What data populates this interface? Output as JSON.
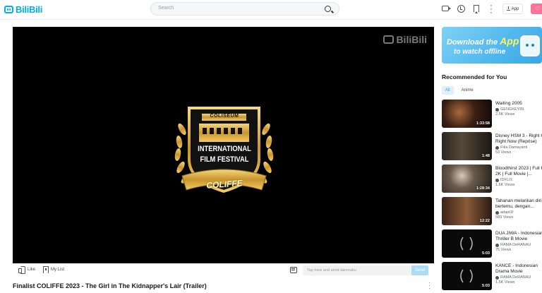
{
  "header": {
    "logo_text": "BiliBili",
    "search_placeholder": "Search",
    "app_label": "App",
    "pink_label": "♡"
  },
  "player": {
    "watermark": "BiliBili",
    "festival": {
      "top": "COLISEUM",
      "line1": "INTERNATIONAL",
      "line2": "FILM FESTIVAL",
      "ribbon": "COLIFFE"
    }
  },
  "toolbar": {
    "like_label": "Like",
    "mylist_label": "My List",
    "danmaku_placeholder": "Tap here and send danmaku",
    "send_label": "Send"
  },
  "video": {
    "title": "Finalist COLIFFE 2023 - The Girl in The Kidnapper's Lair (Trailer)"
  },
  "sidebar": {
    "banner": {
      "line1_a": "Download the ",
      "line1_b": "App",
      "line2": "to watch offline"
    },
    "rec_title": "Recommended for You",
    "tabs": [
      {
        "label": "All",
        "active": true
      },
      {
        "label": "Anime",
        "active": false
      }
    ],
    "items": [
      {
        "title": "Waiting 2005",
        "author": "GENGKEY89",
        "views": "2.5K Views",
        "duration": "1:33:58",
        "thumb": "dark-warm"
      },
      {
        "title": "Disney HSM 3 - Right Here Right Now (Reprise)",
        "author": "Fika Damayanti",
        "views": "53 Views",
        "duration": "1:48",
        "thumb": "dim-room"
      },
      {
        "title": "Bloodthirst 2023 | Full HD 2K | Full Movie |...",
        "author": "IDFLIX",
        "views": "1.6K Views",
        "duration": "1:28:34",
        "thumb": "horror"
      },
      {
        "title": "Tahanan melarikan diri dan bertemu, dengan...",
        "author": "adapt1f",
        "views": "689 Views",
        "duration": "12:22",
        "thumb": "brown"
      },
      {
        "title": "DUA JIWA - Indonesian Thriller B Movie",
        "author": "RAMA DeRANAU",
        "views": "75 Views",
        "duration": "5:03",
        "thumb": "festival"
      },
      {
        "title": "KANCE - Indonesian Drama Movie",
        "author": "RAMA DeRANAU",
        "views": "1.5K Views",
        "duration": "5:03",
        "thumb": "festival"
      }
    ]
  }
}
